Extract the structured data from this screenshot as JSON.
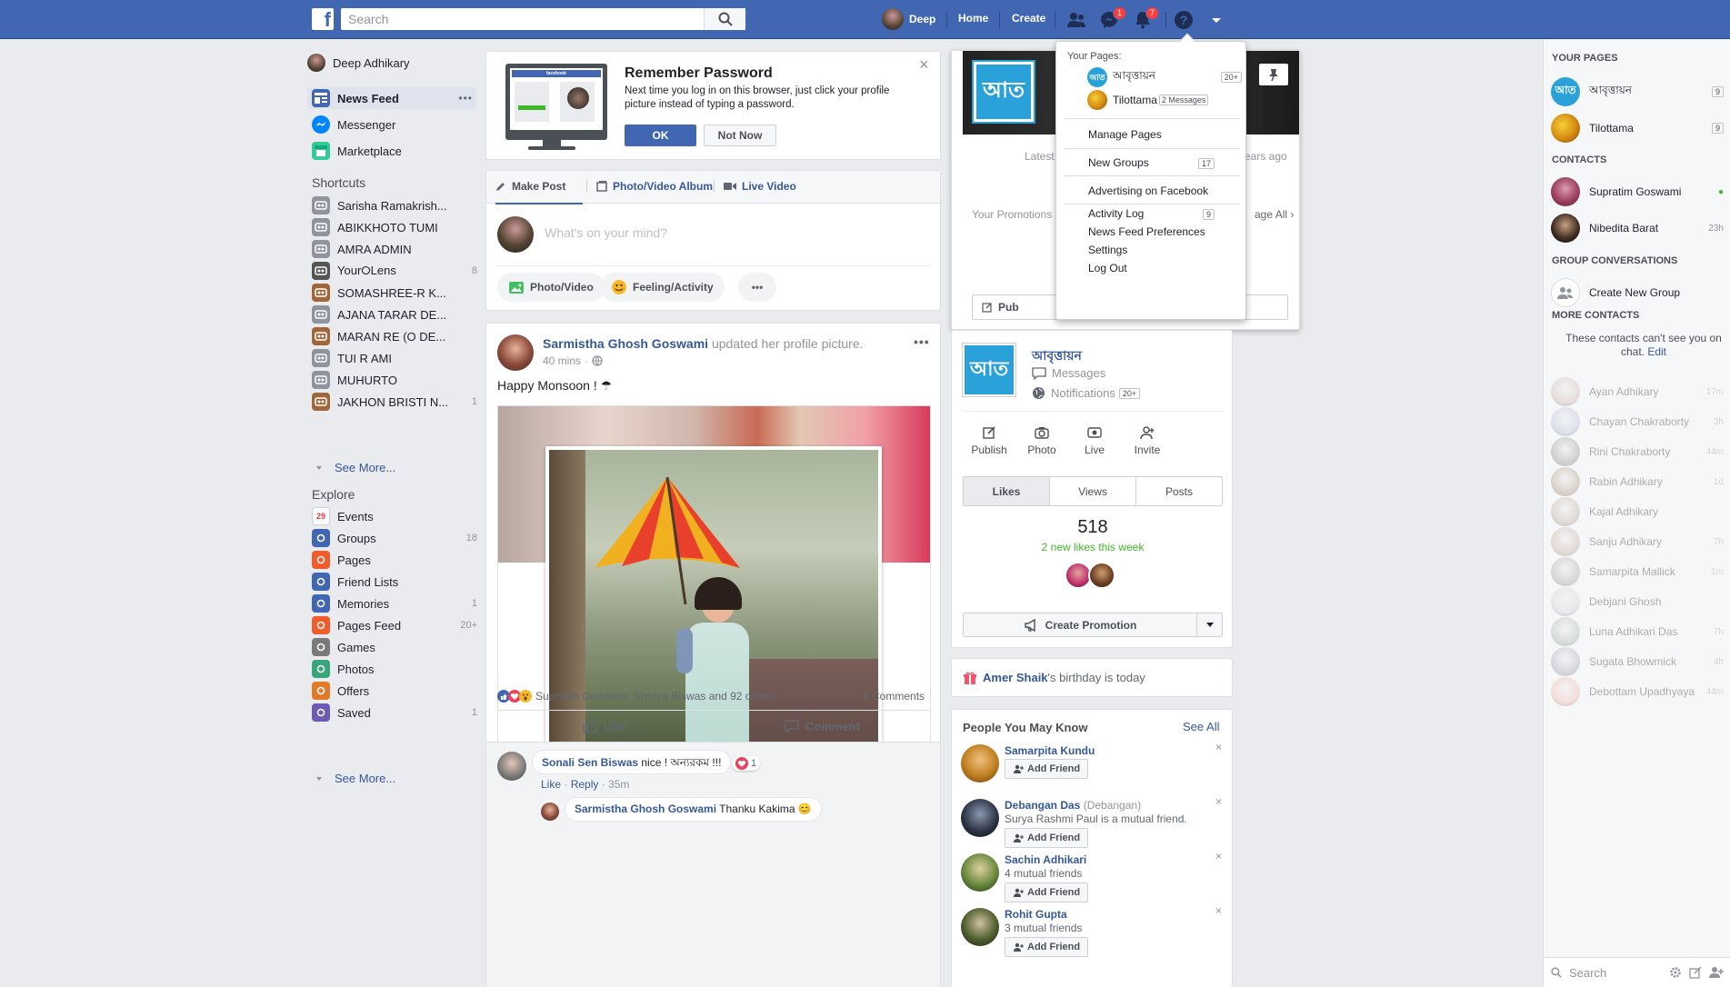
{
  "topbar": {
    "logo": "f",
    "search_placeholder": "Search",
    "user_name": "Deep",
    "home": "Home",
    "create": "Create",
    "messenger_badge": "1",
    "notifications_badge": "7"
  },
  "left_nav": {
    "profile_name": "Deep Adhikary",
    "main": [
      {
        "label": "News Feed",
        "more": "•••"
      },
      {
        "label": "Messenger"
      },
      {
        "label": "Marketplace"
      }
    ],
    "shortcuts_header": "Shortcuts",
    "shortcuts": [
      {
        "label": "Sarisha Ramakrish...",
        "count": ""
      },
      {
        "label": "ABIKKHOTO TUMI",
        "count": ""
      },
      {
        "label": "AMRA ADMIN",
        "count": ""
      },
      {
        "label": "Your⭘Lens",
        "count": "8"
      },
      {
        "label": "SOMASHREE-R K...",
        "count": ""
      },
      {
        "label": "AJANA TARAR DE...",
        "count": ""
      },
      {
        "label": "MARAN RE (O DE...",
        "count": ""
      },
      {
        "label": "TUI R AMI",
        "count": ""
      },
      {
        "label": "MUHURTO",
        "count": ""
      },
      {
        "label": "JAKHON BRISTI N...",
        "count": "1"
      }
    ],
    "see_more_1": "See More...",
    "explore_header": "Explore",
    "explore": [
      {
        "label": "Events",
        "count": ""
      },
      {
        "label": "Groups",
        "count": "18"
      },
      {
        "label": "Pages",
        "count": ""
      },
      {
        "label": "Friend Lists",
        "count": ""
      },
      {
        "label": "Memories",
        "count": "1"
      },
      {
        "label": "Pages Feed",
        "count": "20+"
      },
      {
        "label": "Games",
        "count": ""
      },
      {
        "label": "Photos",
        "count": ""
      },
      {
        "label": "Offers",
        "count": ""
      },
      {
        "label": "Saved",
        "count": "1"
      }
    ],
    "see_more_2": "See More...",
    "events_day": "29"
  },
  "remember": {
    "title": "Remember Password",
    "body": "Next time you log in on this browser, just click your profile picture instead of typing a password.",
    "ok": "OK",
    "not_now": "Not Now",
    "close": "×",
    "mock_header": "facebook"
  },
  "composer": {
    "tabs": [
      "Make Post",
      "Photo/Video Album",
      "Live Video"
    ],
    "placeholder": "What's on your mind?",
    "actions": [
      "Photo/Video",
      "Feeling/Activity",
      "•••"
    ]
  },
  "post": {
    "author": "Sarmistha Ghosh Goswami",
    "action": " updated her profile picture.",
    "time": "40 mins",
    "dots": "•••",
    "text": "Happy Monsoon ! ☂",
    "reactions_text": "Supratim Goswami, Shreya Biswas and 92 others",
    "comments_count": "4 Comments",
    "like": "Like",
    "comment": "Comment",
    "comment1_author": "Sonali Sen Biswas",
    "comment1_text": " nice ! অন্যরকম !!!",
    "comment1_reacts": "1",
    "comment1_like": "Like",
    "comment1_reply": "Reply",
    "comment1_time": "35m",
    "reply1_author": "Sarmistha Ghosh Goswami",
    "reply1_text": " Thanku Kakima 😊"
  },
  "page_panel": {
    "latest": "Latest",
    "years_ago": "ears ago",
    "promotions": "Your Promotions",
    "manage_all": "age All ›",
    "publish_short": "Pub",
    "name": "আবৃত্তায়ন",
    "logo_text": "আত",
    "messages": "Messages",
    "notifications": "Notifications",
    "notif_count": "20+",
    "actions": [
      "Publish",
      "Photo",
      "Live",
      "Invite"
    ],
    "tabs": [
      "Likes",
      "Views",
      "Posts"
    ],
    "likes": "518",
    "new_likes": "2 new likes this week",
    "create_promotion": "Create Promotion"
  },
  "birthday": {
    "name": "Amer Shaik",
    "text": "'s birthday is today"
  },
  "pymk": {
    "title": "People You May Know",
    "see_all": "See All",
    "add_friend": "Add Friend",
    "people": [
      {
        "name": "Samarpita Kundu",
        "extra": "",
        "sub": ""
      },
      {
        "name": "Debangan Das",
        "extra": " (Debangan)",
        "sub": "Surya Rashmi Paul is a mutual friend."
      },
      {
        "name": "Sachin Adhikari",
        "extra": "",
        "sub": "4 mutual friends"
      },
      {
        "name": "Rohit Gupta",
        "extra": "",
        "sub": "3 mutual friends"
      }
    ]
  },
  "dropdown": {
    "your_pages": "Your Pages:",
    "pages": [
      {
        "name": "আবৃত্তায়ন",
        "count": "20+"
      },
      {
        "name": "Tilottama",
        "count": "2 Messages"
      }
    ],
    "items": [
      {
        "label": "Manage Pages",
        "count": ""
      },
      {
        "label": "New Groups",
        "count": "17"
      },
      {
        "label": "Advertising on Facebook",
        "count": ""
      },
      {
        "label": "Activity Log",
        "count": "9"
      },
      {
        "label": "News Feed Preferences",
        "count": ""
      },
      {
        "label": "Settings",
        "count": ""
      },
      {
        "label": "Log Out",
        "count": ""
      }
    ]
  },
  "chat": {
    "your_pages": "YOUR PAGES",
    "pages": [
      {
        "name": "আবৃত্তায়ন",
        "count": "9"
      },
      {
        "name": "Tilottama",
        "count": "9"
      }
    ],
    "contacts": "CONTACTS",
    "contact_list": [
      {
        "name": "Supratim Goswami",
        "time": "●"
      },
      {
        "name": "Nibedita Barat",
        "time": "23h"
      }
    ],
    "group_conv": "GROUP CONVERSATIONS",
    "create_group": "Create New Group",
    "more_contacts": "MORE CONTACTS",
    "unavailable": "These contacts can't see you on chat.",
    "edit": "Edit",
    "more_list": [
      {
        "name": "Ayan Adhikary",
        "time": "17m"
      },
      {
        "name": "Chayan Chakraborty",
        "time": "3h"
      },
      {
        "name": "Rini Chakraborty",
        "time": "44m"
      },
      {
        "name": "Rabin Adhikary",
        "time": "1d"
      },
      {
        "name": "Kajal Adhikary",
        "time": ""
      },
      {
        "name": "Sanju Adhikary",
        "time": "7h"
      },
      {
        "name": "Samarpita Mallick",
        "time": "1m"
      },
      {
        "name": "Debjani Ghosh",
        "time": ""
      },
      {
        "name": "Luna Adhikari Das",
        "time": "7h"
      },
      {
        "name": "Sugata Bhowmick",
        "time": "4h"
      },
      {
        "name": "Debottam Upadhyaya",
        "time": "44m"
      }
    ],
    "search": "Search"
  }
}
